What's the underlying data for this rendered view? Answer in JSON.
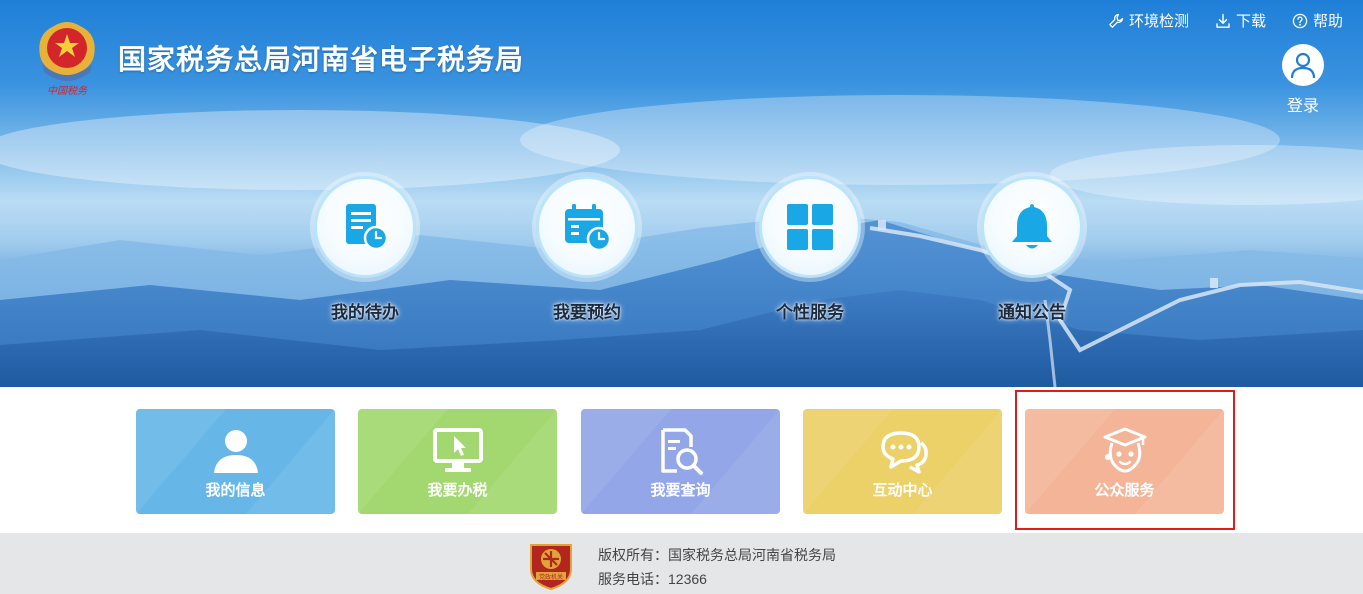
{
  "header": {
    "title": "国家税务总局河南省电子税务局",
    "emblem_caption": "中国税务",
    "links": [
      {
        "label": "环境检测",
        "icon": "wrench-icon"
      },
      {
        "label": "下载",
        "icon": "download-icon"
      },
      {
        "label": "帮助",
        "icon": "help-icon"
      }
    ],
    "login_label": "登录"
  },
  "features": [
    {
      "label": "我的待办",
      "icon": "todo-document-icon"
    },
    {
      "label": "我要预约",
      "icon": "calendar-clock-icon"
    },
    {
      "label": "个性服务",
      "icon": "grid-icon"
    },
    {
      "label": "通知公告",
      "icon": "bell-icon"
    }
  ],
  "tiles": [
    {
      "label": "我的信息",
      "icon": "user-icon",
      "color": "#66b7e8"
    },
    {
      "label": "我要办税",
      "icon": "monitor-cursor-icon",
      "color": "#a2d86f"
    },
    {
      "label": "我要查询",
      "icon": "document-search-icon",
      "color": "#93a7e8"
    },
    {
      "label": "互动中心",
      "icon": "chat-bubbles-icon",
      "color": "#ecd068"
    },
    {
      "label": "公众服务",
      "icon": "graduate-face-icon",
      "color": "#f4b497"
    }
  ],
  "footer": {
    "copyright": "版权所有：国家税务总局河南省税务局",
    "phone": "服务电话：12366",
    "badge_caption": "党政机关"
  },
  "colors": {
    "banner_blue": "#1f7fd8",
    "feature_icon": "#19a7e6",
    "highlight": "#e01b1b",
    "footer_bg": "#e4e6e8"
  }
}
